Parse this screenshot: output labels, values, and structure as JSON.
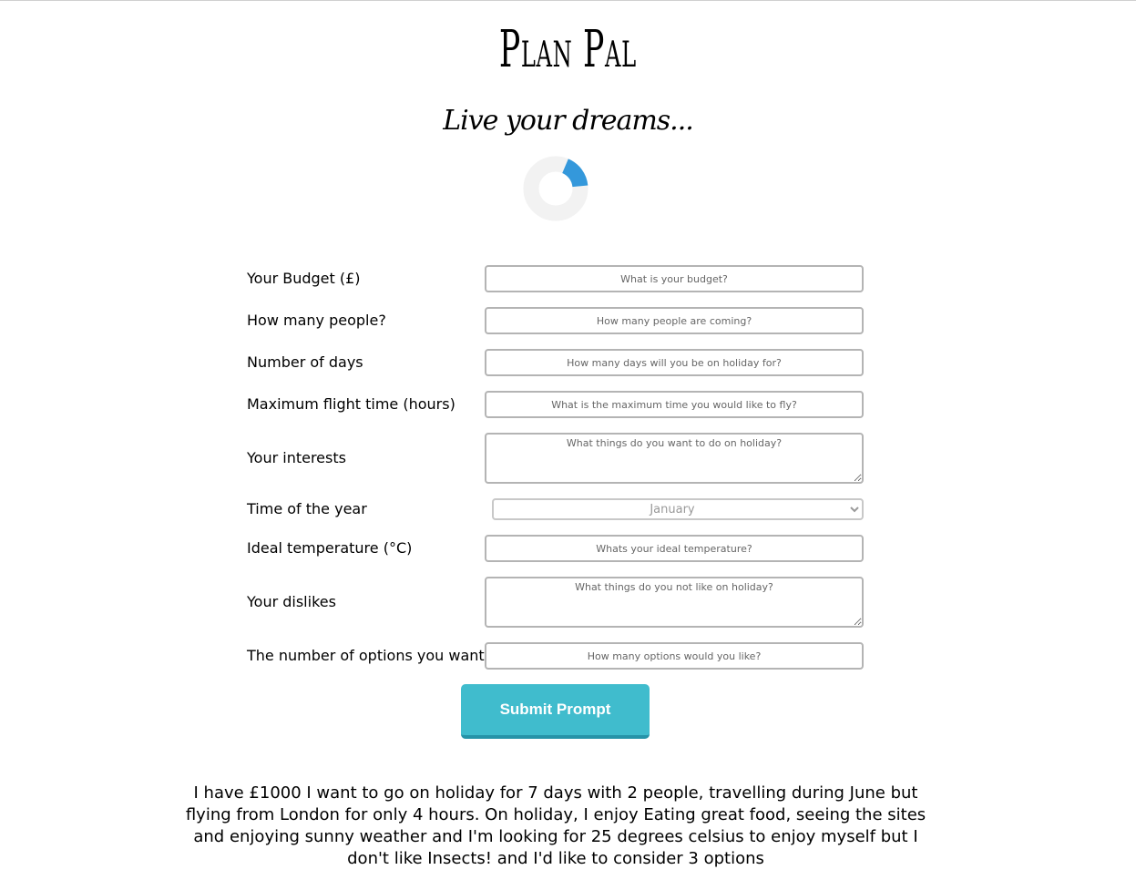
{
  "app": {
    "title": "Plan Pal",
    "tagline": "Live your dreams..."
  },
  "loading": {
    "progress": 0.17,
    "track_color": "#f2f2f2",
    "arc_color": "#3498db"
  },
  "form": {
    "budget": {
      "label": "Your Budget (£)",
      "placeholder": "What is your budget?"
    },
    "people": {
      "label": "How many people?",
      "placeholder": "How many people are coming?"
    },
    "days": {
      "label": "Number of days",
      "placeholder": "How many days will you be on holiday for?"
    },
    "flight_time": {
      "label": "Maximum flight time (hours)",
      "placeholder": "What is the maximum time you would like to fly?"
    },
    "interests": {
      "label": "Your interests",
      "placeholder": "What things do you want to do on holiday?"
    },
    "time_of_year": {
      "label": "Time of the year",
      "selected": "January"
    },
    "temperature": {
      "label": "Ideal temperature (°C)",
      "placeholder": "Whats your ideal temperature?"
    },
    "dislikes": {
      "label": "Your dislikes",
      "placeholder": "What things do you not like on holiday?"
    },
    "options": {
      "label": "The number of options you want",
      "placeholder": "How many options would you like?"
    },
    "submit_label": "Submit Prompt",
    "submit_color": "#40bccd"
  },
  "result": {
    "text": "I have £1000 I want to go on holiday for 7 days with 2 people, travelling during June but flying from London for only 4 hours. On holiday, I enjoy Eating great food, seeing the sites and enjoying sunny weather and I'm looking for 25 degrees celsius to enjoy myself but I don't like Insects! and I'd like to consider 3 options"
  }
}
